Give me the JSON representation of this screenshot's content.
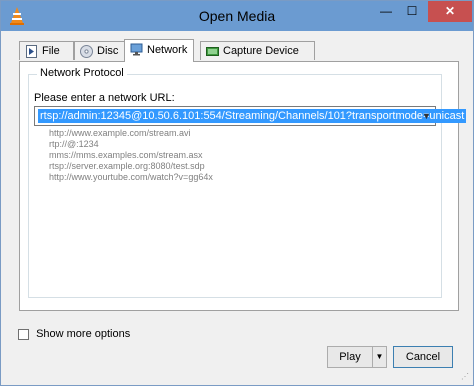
{
  "window": {
    "title": "Open Media",
    "minimize_glyph": "—",
    "maximize_glyph": "☐",
    "close_glyph": "✕"
  },
  "tabs": [
    {
      "label": "File",
      "icon": "file-icon"
    },
    {
      "label": "Disc",
      "icon": "disc-icon"
    },
    {
      "label": "Network",
      "icon": "network-icon",
      "active": true
    },
    {
      "label": "Capture Device",
      "icon": "capture-device-icon"
    }
  ],
  "network": {
    "group_label": "Network Protocol",
    "url_prompt": "Please enter a network URL:",
    "url_value": "rtsp://admin:12345@10.50.6.101:554/Streaming/Channels/101?transportmode=unicast",
    "examples": [
      "http://www.example.com/stream.avi",
      "rtp://@:1234",
      "mms://mms.examples.com/stream.asx",
      "rtsp://server.example.org:8080/test.sdp",
      "http://www.yourtube.com/watch?v=gg64x"
    ]
  },
  "options": {
    "show_more_label": "Show more options",
    "show_more_checked": false
  },
  "buttons": {
    "play": "Play",
    "cancel": "Cancel"
  },
  "colors": {
    "titlebar": "#6b9bd1",
    "selection": "#3399ff",
    "close": "#c75050"
  }
}
